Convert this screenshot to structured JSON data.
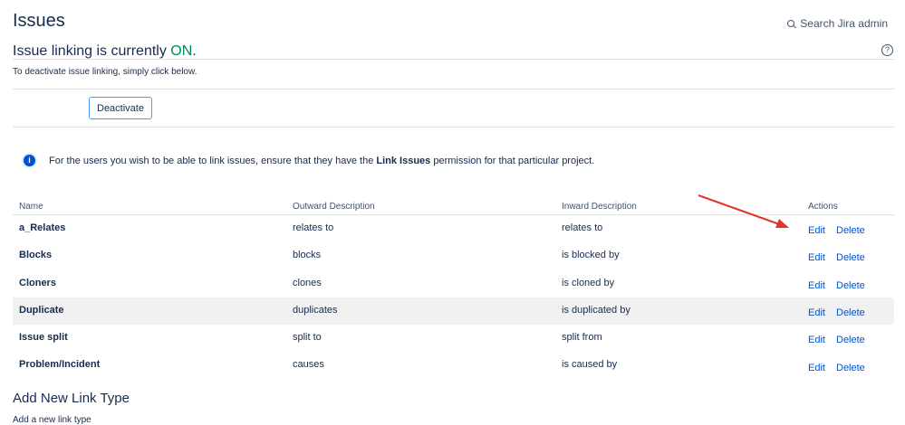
{
  "header": {
    "title": "Issues",
    "search_label": "Search Jira admin",
    "search_icon": "search-icon",
    "help_icon": "help-icon"
  },
  "linking": {
    "heading_prefix": "Issue linking is currently ",
    "status": "ON",
    "heading_suffix": ".",
    "status_color": "#00875a",
    "instruction": "To deactivate issue linking, simply click below.",
    "deactivate_label": "Deactivate"
  },
  "notice": {
    "icon": "info-icon",
    "text_before": "For the users you wish to be able to link issues, ensure that they have the ",
    "permission": "Link Issues",
    "text_after": " permission for that particular project."
  },
  "table": {
    "headers": [
      "Name",
      "Outward Description",
      "Inward Description",
      "Actions"
    ],
    "rows": [
      {
        "name": "a_Relates",
        "outward": "relates to",
        "inward": "relates to",
        "edit": "Edit",
        "delete": "Delete"
      },
      {
        "name": "Blocks",
        "outward": "blocks",
        "inward": "is blocked by",
        "edit": "Edit",
        "delete": "Delete"
      },
      {
        "name": "Cloners",
        "outward": "clones",
        "inward": "is cloned by",
        "edit": "Edit",
        "delete": "Delete"
      },
      {
        "name": "Duplicate",
        "outward": "duplicates",
        "inward": "is duplicated by",
        "edit": "Edit",
        "delete": "Delete"
      },
      {
        "name": "Issue split",
        "outward": "split to",
        "inward": "split from",
        "edit": "Edit",
        "delete": "Delete"
      },
      {
        "name": "Problem/Incident",
        "outward": "causes",
        "inward": "is caused by",
        "edit": "Edit",
        "delete": "Delete"
      }
    ]
  },
  "add_link": {
    "title": "Add New Link Type",
    "subtitle": "Add a new link type"
  },
  "annotation": {
    "arrow_color": "#e3342f"
  }
}
